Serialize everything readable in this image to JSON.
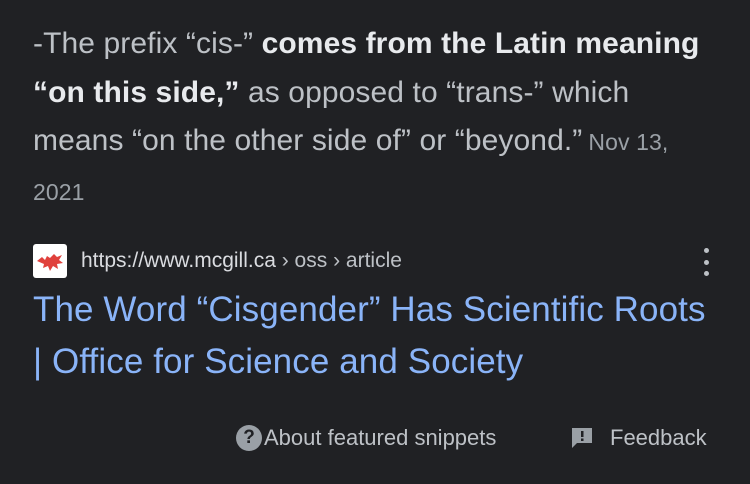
{
  "snippet": {
    "part1": "-The prefix “cis-” ",
    "bold": "comes from the Latin meaning “on this side,”",
    "part2": " as opposed to “trans-” which means “on the other side of” or “beyond.”",
    "date": "Nov 13, 2021"
  },
  "source": {
    "url": "https://www.mcgill.ca",
    "breadcrumbs": " › oss › article",
    "favicon": "mcgill-favicon",
    "favicon_color": "#e0413c"
  },
  "result": {
    "title": "The Word “Cisgender” Has Scientific Roots | Office for Science and Society",
    "link_color": "#8ab4f8"
  },
  "footer": {
    "about_label": "About featured snippets",
    "about_icon": "question-circle-icon",
    "feedback_label": "Feedback",
    "feedback_icon": "feedback-icon"
  }
}
